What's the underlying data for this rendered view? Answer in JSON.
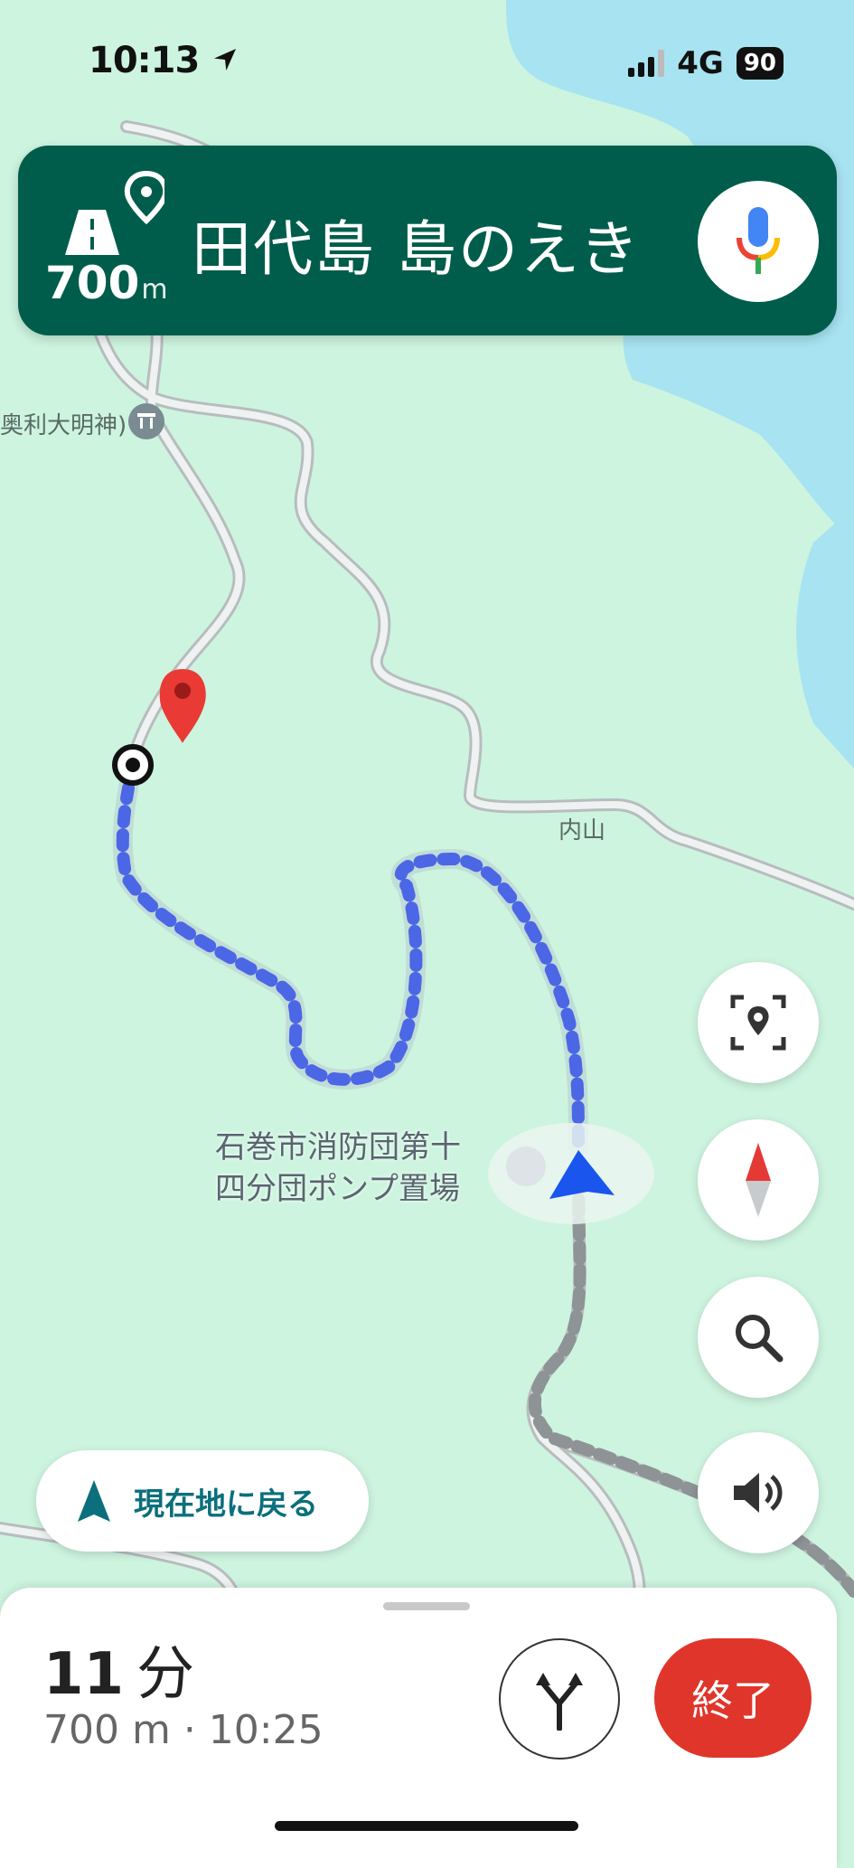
{
  "status_bar": {
    "time": "10:13",
    "network": "4G",
    "battery": "90"
  },
  "nav": {
    "distance_value": "700",
    "distance_unit": "m",
    "destination": "田代島 島のえき"
  },
  "map_labels": {
    "shrine": "奥利大明神)",
    "area": "内山",
    "poi_line1": "石巻市消防団第十",
    "poi_line2": "四分団ポンプ置場"
  },
  "buttons": {
    "recenter": "現在地に戻る",
    "end": "終了"
  },
  "trip": {
    "minutes": "11",
    "minutes_unit": "分",
    "summary": "700 m · 10:25"
  },
  "icons": {
    "nav_direction": "road-destination-icon",
    "mic": "google-mic-icon",
    "location_arrow": "location-arrow-icon",
    "recenter": "navigation-arrow-icon",
    "alternate_routes": "fork-arrows-icon",
    "camera_search": "focus-pin-icon",
    "compass": "compass-icon",
    "search": "search-icon",
    "sound": "volume-icon"
  },
  "colors": {
    "header": "#015d4b",
    "route": "#1a3ff5",
    "end_button": "#e0352b",
    "accent": "#0b6f7c"
  }
}
